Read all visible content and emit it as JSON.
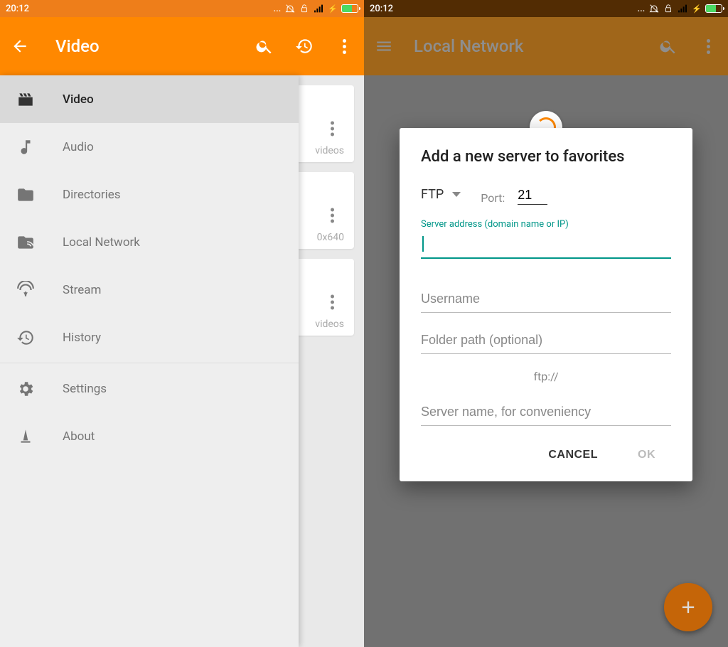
{
  "status": {
    "time": "20:12"
  },
  "left": {
    "appbar": {
      "title": "Video"
    },
    "drawer": {
      "items": [
        {
          "label": "Video",
          "selected": true
        },
        {
          "label": "Audio"
        },
        {
          "label": "Directories"
        },
        {
          "label": "Local Network"
        },
        {
          "label": "Stream"
        },
        {
          "label": "History"
        }
      ],
      "footer": [
        {
          "label": "Settings"
        },
        {
          "label": "About"
        }
      ]
    },
    "bg_cards": [
      {
        "label": "videos"
      },
      {
        "label": "0x640"
      },
      {
        "label": "videos"
      }
    ]
  },
  "right": {
    "appbar": {
      "title": "Local Network"
    },
    "dialog": {
      "title": "Add a new server to favorites",
      "protocol": "FTP",
      "port_label": "Port:",
      "port_value": "21",
      "server_label": "Server address (domain name or IP)",
      "username_placeholder": "Username",
      "folder_placeholder": "Folder path (optional)",
      "url_preview": "ftp://",
      "servername_placeholder": "Server name, for conveniency",
      "cancel": "CANCEL",
      "ok": "OK"
    }
  }
}
